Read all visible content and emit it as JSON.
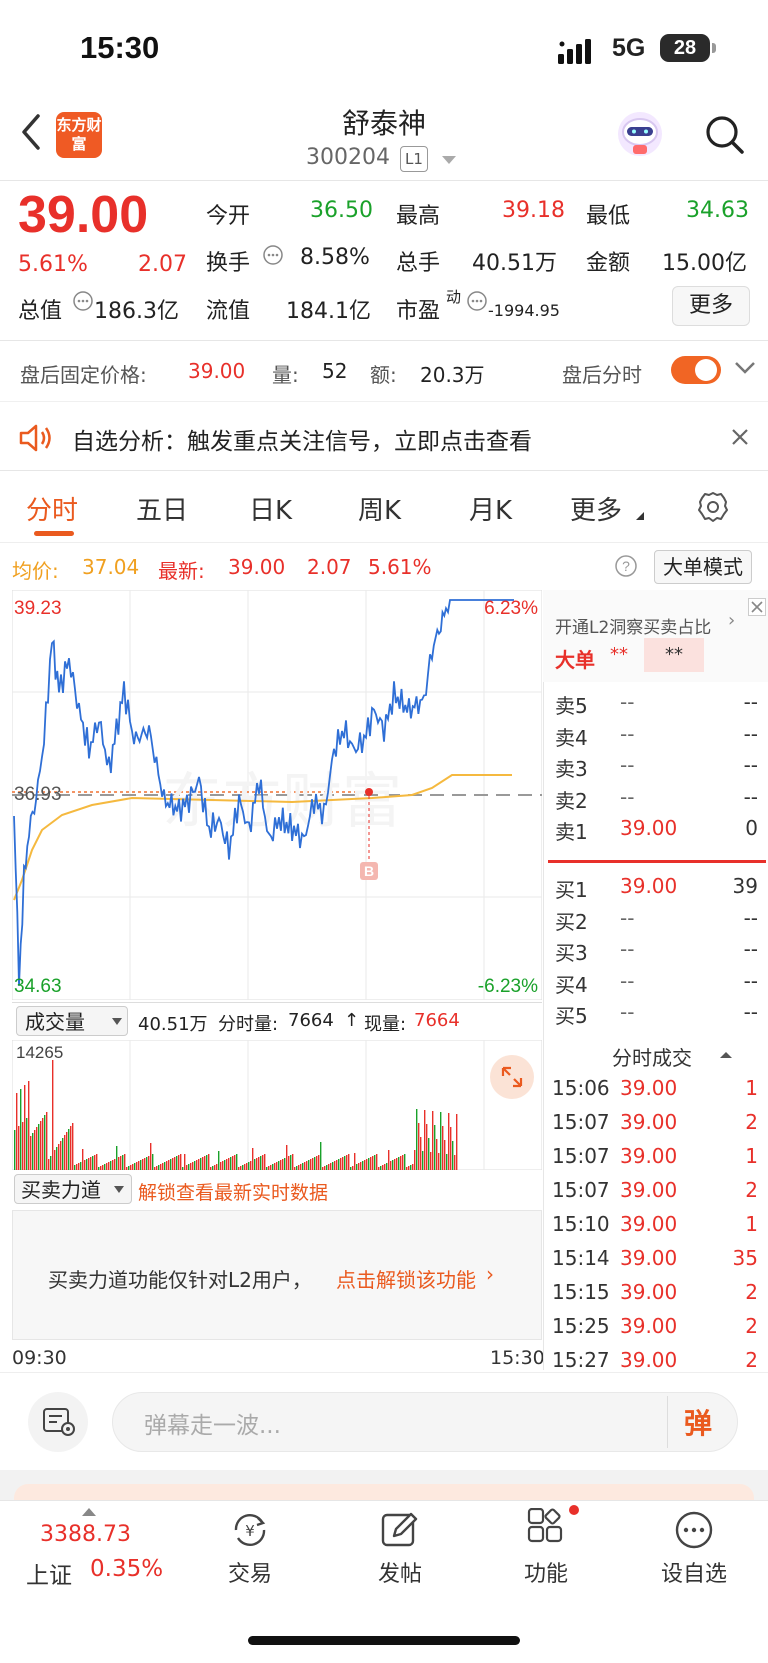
{
  "status": {
    "time": "15:30",
    "network": "5G",
    "battery": "28"
  },
  "header": {
    "name": "舒泰神",
    "code": "300204",
    "level_badge": "L1",
    "logo_text": "东方财富"
  },
  "quote": {
    "price": "39.00",
    "change_pct": "5.61%",
    "change": "2.07",
    "open_label": "今开",
    "open": "36.50",
    "high_label": "最高",
    "high": "39.18",
    "low_label": "最低",
    "low": "34.63",
    "turnover_label": "换手",
    "turnover": "8.58%",
    "volume_label": "总手",
    "volume": "40.51万",
    "amount_label": "金额",
    "amount": "15.00亿",
    "mktcap_label": "总值",
    "mktcap": "186.3亿",
    "float_label": "流值",
    "float_cap": "184.1亿",
    "pe_label": "市盈",
    "pe_sup": "动",
    "pe": "-1994.95",
    "more_button": "更多"
  },
  "after_hours": {
    "price_label": "盘后固定价格:",
    "price": "39.00",
    "vol_label": "量:",
    "vol": "52",
    "amt_label": "额:",
    "amt": "20.3万",
    "switch_label": "盘后分时",
    "switch_on": true
  },
  "notice": {
    "text": "自选分析：触发重点关注信号，立即点击查看"
  },
  "tabs": [
    {
      "label": "分时",
      "active": true
    },
    {
      "label": "五日"
    },
    {
      "label": "日K"
    },
    {
      "label": "周K"
    },
    {
      "label": "月K"
    },
    {
      "label": "更多"
    }
  ],
  "chart_info": {
    "avg_label": "均价:",
    "avg": "37.04",
    "latest_label": "最新:",
    "latest": "39.00",
    "latest_change": "2.07",
    "latest_pct": "5.61%",
    "mode_button": "大单模式",
    "y_top": "39.23",
    "y_mid": "36.93",
    "y_bottom": "34.63",
    "pct_top": "6.23%",
    "pct_bottom": "-6.23%",
    "marker": "B",
    "watermark": "东方财富",
    "time_start": "09:30",
    "time_end": "15:30"
  },
  "volume_panel": {
    "selector": "成交量",
    "total": "40.51万",
    "fs_label": "分时量:",
    "fs_value": "7664",
    "now_label": "现量:",
    "now_value": "7664",
    "max": "14265"
  },
  "force_panel": {
    "selector": "买卖力道",
    "unlock_link": "解锁查看最新实时数据",
    "message": "买卖力道功能仅针对L2用户，",
    "message_link": "点击解锁该功能"
  },
  "orderbook": {
    "promo": "开通L2洞察买卖占比",
    "big_label": "大单",
    "big_value": "**",
    "big_badge": "**",
    "sells": [
      {
        "label": "卖5",
        "price": "--",
        "vol": "--"
      },
      {
        "label": "卖4",
        "price": "--",
        "vol": "--"
      },
      {
        "label": "卖3",
        "price": "--",
        "vol": "--"
      },
      {
        "label": "卖2",
        "price": "--",
        "vol": "--"
      },
      {
        "label": "卖1",
        "price": "39.00",
        "vol": "0"
      }
    ],
    "buys": [
      {
        "label": "买1",
        "price": "39.00",
        "vol": "39"
      },
      {
        "label": "买2",
        "price": "--",
        "vol": "--"
      },
      {
        "label": "买3",
        "price": "--",
        "vol": "--"
      },
      {
        "label": "买4",
        "price": "--",
        "vol": "--"
      },
      {
        "label": "买5",
        "price": "--",
        "vol": "--"
      }
    ],
    "trades_title": "分时成交",
    "trades": [
      {
        "time": "15:06",
        "price": "39.00",
        "vol": "1"
      },
      {
        "time": "15:07",
        "price": "39.00",
        "vol": "2"
      },
      {
        "time": "15:07",
        "price": "39.00",
        "vol": "1"
      },
      {
        "time": "15:07",
        "price": "39.00",
        "vol": "2"
      },
      {
        "time": "15:10",
        "price": "39.00",
        "vol": "1"
      },
      {
        "time": "15:14",
        "price": "39.00",
        "vol": "35"
      },
      {
        "time": "15:15",
        "price": "39.00",
        "vol": "2"
      },
      {
        "time": "15:25",
        "price": "39.00",
        "vol": "2"
      },
      {
        "time": "15:27",
        "price": "39.00",
        "vol": "2"
      }
    ]
  },
  "comment": {
    "placeholder": "弹幕走一波...",
    "send": "弹"
  },
  "bottom_nav": {
    "index_value": "3388.73",
    "index_name": "上证",
    "index_pct": "0.35%",
    "items": [
      {
        "label": "交易"
      },
      {
        "label": "发帖"
      },
      {
        "label": "功能"
      },
      {
        "label": "设自选"
      }
    ]
  },
  "colors": {
    "up": "#e8302a",
    "down": "#1aa12a",
    "accent": "#ea5a1f",
    "price_line": "#2f6fd6",
    "avg_line": "#f5b93f"
  }
}
